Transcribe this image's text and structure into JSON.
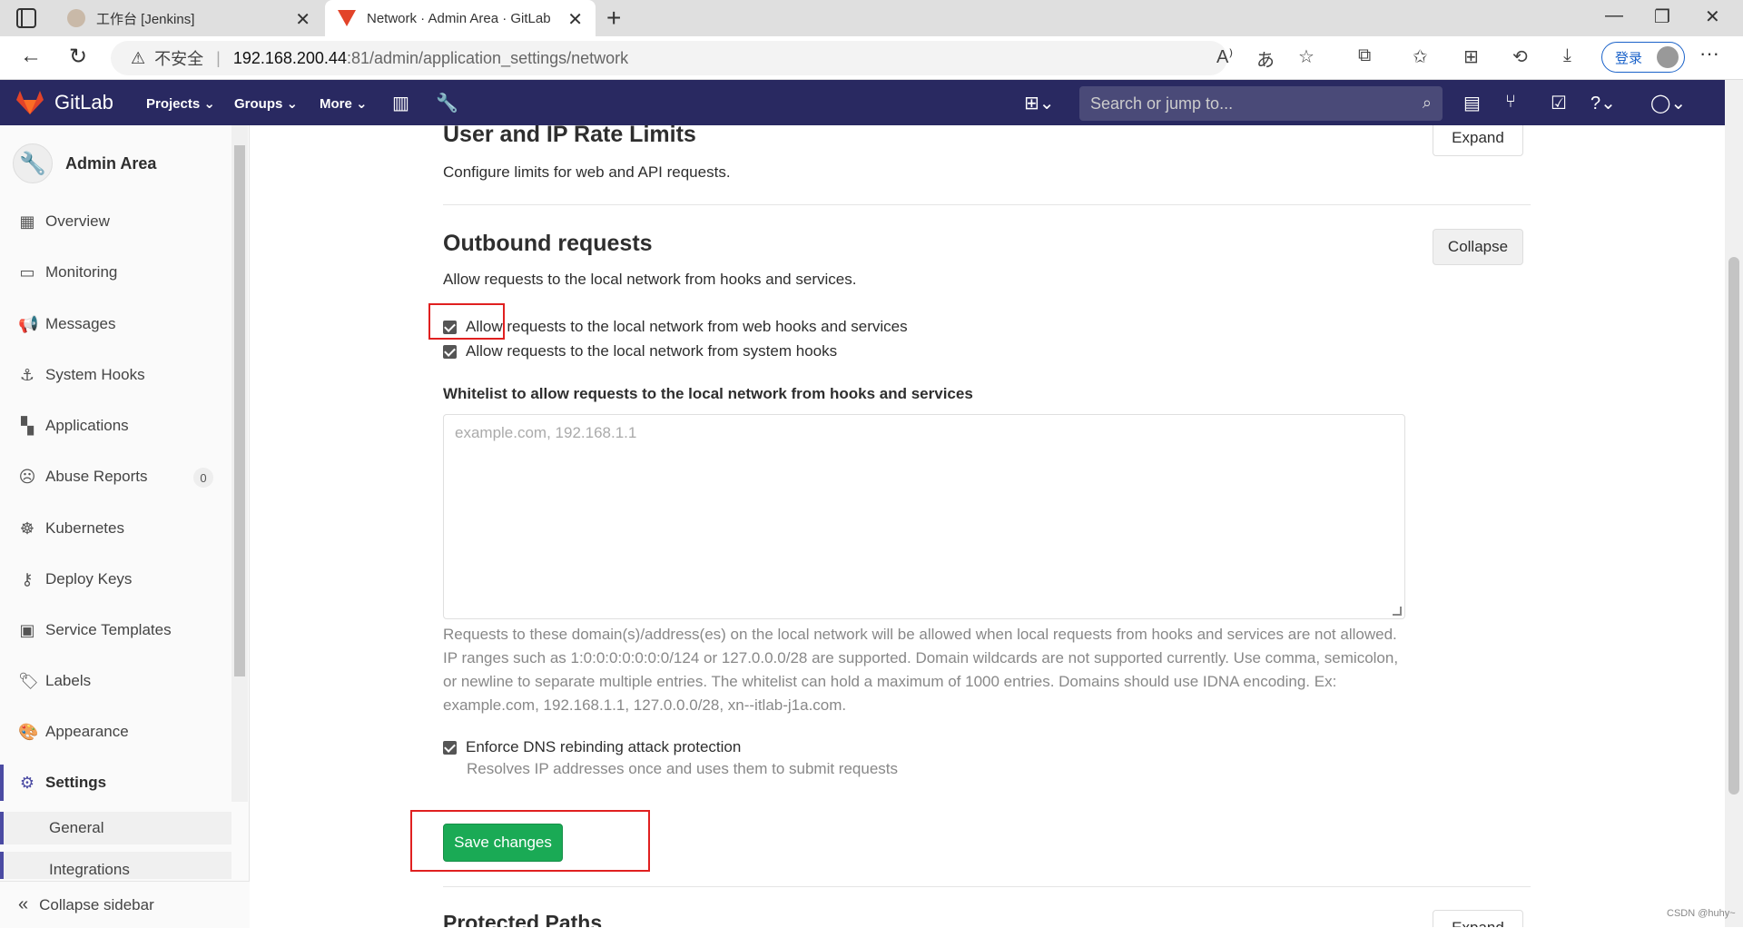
{
  "browser": {
    "tabs": [
      {
        "title": "工作台 [Jenkins]"
      },
      {
        "title": "Network · Admin Area · GitLab"
      }
    ],
    "url": {
      "security": "不安全",
      "host": "192.168.200.44",
      "path": ":81/admin/application_settings/network"
    },
    "login_label": "登录"
  },
  "header": {
    "brand": "GitLab",
    "nav": [
      "Projects",
      "Groups",
      "More"
    ],
    "search_placeholder": "Search or jump to..."
  },
  "sidebar": {
    "title": "Admin Area",
    "items": [
      {
        "label": "Overview",
        "icon": "overview-icon"
      },
      {
        "label": "Monitoring",
        "icon": "monitor-icon"
      },
      {
        "label": "Messages",
        "icon": "megaphone-icon"
      },
      {
        "label": "System Hooks",
        "icon": "hook-icon"
      },
      {
        "label": "Applications",
        "icon": "grid-icon"
      },
      {
        "label": "Abuse Reports",
        "icon": "sad-face-icon",
        "badge": "0"
      },
      {
        "label": "Kubernetes",
        "icon": "kubernetes-icon"
      },
      {
        "label": "Deploy Keys",
        "icon": "key-icon"
      },
      {
        "label": "Service Templates",
        "icon": "template-icon"
      },
      {
        "label": "Labels",
        "icon": "label-icon"
      },
      {
        "label": "Appearance",
        "icon": "palette-icon"
      },
      {
        "label": "Settings",
        "icon": "gear-icon",
        "active": true
      }
    ],
    "sub_items": [
      "General",
      "Integrations"
    ],
    "collapse_label": "Collapse sidebar"
  },
  "main": {
    "rate_limits": {
      "title": "User and IP Rate Limits",
      "description": "Configure limits for web and API requests.",
      "button": "Expand"
    },
    "outbound": {
      "title": "Outbound requests",
      "description": "Allow requests to the local network from hooks and services.",
      "button": "Collapse",
      "checkbox_webhooks": "Allow requests to the local network from web hooks and services",
      "checkbox_systemhooks": "Allow requests to the local network from system hooks",
      "whitelist_label": "Whitelist to allow requests to the local network from hooks and services",
      "whitelist_placeholder": "example.com, 192.168.1.1",
      "whitelist_value": "",
      "help_text": "Requests to these domain(s)/address(es) on the local network will be allowed when local requests from hooks and services are not allowed. IP ranges such as 1:0:0:0:0:0:0:0/124 or 127.0.0.0/28 are supported. Domain wildcards are not supported currently. Use comma, semicolon, or newline to separate multiple entries. The whitelist can hold a maximum of 1000 entries. Domains should use IDNA encoding. Ex: example.com, 192.168.1.1, 127.0.0.0/28, xn--itlab-j1a.com.",
      "dns_checkbox": "Enforce DNS rebinding attack protection",
      "dns_help": "Resolves IP addresses once and uses them to submit requests",
      "save_button": "Save changes"
    },
    "protected_paths": {
      "title": "Protected Paths",
      "button": "Expand"
    }
  },
  "watermark": "CSDN @huhy~",
  "colors": {
    "header_bg": "#292961",
    "save_green": "#1aaa55",
    "highlight_red": "#e02020"
  }
}
